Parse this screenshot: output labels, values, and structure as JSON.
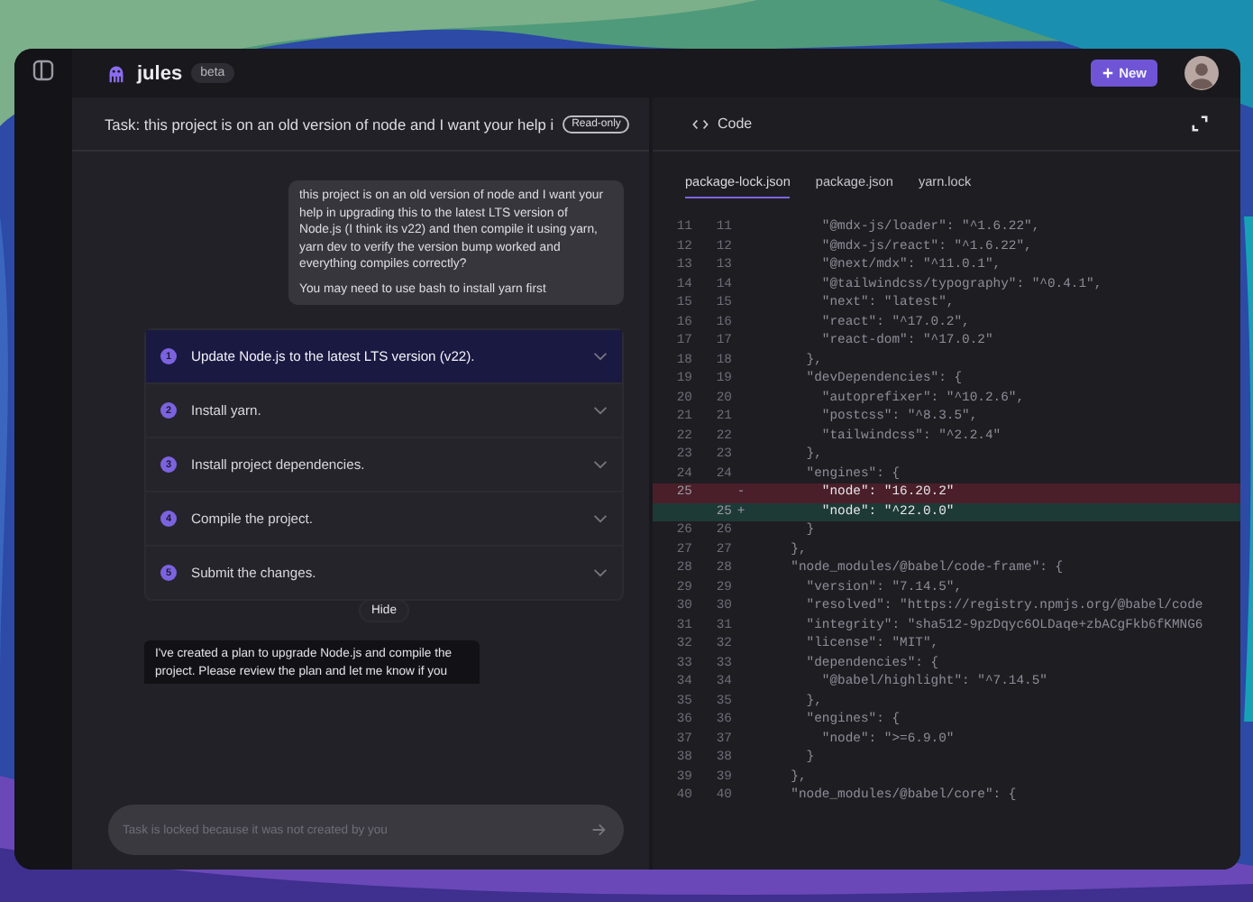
{
  "app": {
    "name": "jules",
    "badge": "beta"
  },
  "new_button": {
    "label": "New"
  },
  "task": {
    "title": "Task: this project is on an old version of node and I want your help i",
    "badge": "Read-only"
  },
  "user_message": {
    "paragraphs": [
      "this project is on an old version of node and I want your help in upgrading this to the latest LTS version of Node.js (I think its v22) and then compile it using yarn, yarn dev to verify the version bump worked and everything compiles correctly?",
      "You may need to use bash to install yarn first"
    ]
  },
  "plan": {
    "steps": [
      {
        "number": "1",
        "text": "Update Node.js to the latest LTS version (v22).",
        "selected": true
      },
      {
        "number": "2",
        "text": "Install yarn.",
        "selected": false
      },
      {
        "number": "3",
        "text": "Install project dependencies.",
        "selected": false
      },
      {
        "number": "4",
        "text": "Compile the project.",
        "selected": false
      },
      {
        "number": "5",
        "text": "Submit the changes.",
        "selected": false
      }
    ],
    "toggle": "Hide"
  },
  "assistant_message": {
    "text": "I've created a plan to upgrade Node.js and compile the project. Please review the plan and let me know if you"
  },
  "composer": {
    "placeholder": "Task is locked because it was not created by you"
  },
  "code_panel": {
    "title": "Code",
    "tabs": [
      {
        "label": "package-lock.json",
        "selected": true
      },
      {
        "label": "package.json",
        "selected": false
      },
      {
        "label": "yarn.lock",
        "selected": false
      }
    ],
    "lines": [
      {
        "kind": "context",
        "old": "11",
        "new": "11",
        "text": "      \"@mdx-js/loader\": \"^1.6.22\","
      },
      {
        "kind": "context",
        "old": "12",
        "new": "12",
        "text": "      \"@mdx-js/react\": \"^1.6.22\","
      },
      {
        "kind": "context",
        "old": "13",
        "new": "13",
        "text": "      \"@next/mdx\": \"^11.0.1\","
      },
      {
        "kind": "context",
        "old": "14",
        "new": "14",
        "text": "      \"@tailwindcss/typography\": \"^0.4.1\","
      },
      {
        "kind": "context",
        "old": "15",
        "new": "15",
        "text": "      \"next\": \"latest\","
      },
      {
        "kind": "context",
        "old": "16",
        "new": "16",
        "text": "      \"react\": \"^17.0.2\","
      },
      {
        "kind": "context",
        "old": "17",
        "new": "17",
        "text": "      \"react-dom\": \"^17.0.2\""
      },
      {
        "kind": "context",
        "old": "18",
        "new": "18",
        "text": "    },"
      },
      {
        "kind": "context",
        "old": "19",
        "new": "19",
        "text": "    \"devDependencies\": {"
      },
      {
        "kind": "context",
        "old": "20",
        "new": "20",
        "text": "      \"autoprefixer\": \"^10.2.6\","
      },
      {
        "kind": "context",
        "old": "21",
        "new": "21",
        "text": "      \"postcss\": \"^8.3.5\","
      },
      {
        "kind": "context",
        "old": "22",
        "new": "22",
        "text": "      \"tailwindcss\": \"^2.2.4\""
      },
      {
        "kind": "context",
        "old": "23",
        "new": "23",
        "text": "    },"
      },
      {
        "kind": "context",
        "old": "24",
        "new": "24",
        "text": "    \"engines\": {"
      },
      {
        "kind": "removed",
        "old": "25",
        "marker": "-",
        "text": "      \"node\": \"16.20.2\""
      },
      {
        "kind": "added",
        "new": "25",
        "marker": "+",
        "text": "      \"node\": \"^22.0.0\""
      },
      {
        "kind": "context",
        "old": "26",
        "new": "26",
        "text": "    }"
      },
      {
        "kind": "context",
        "old": "27",
        "new": "27",
        "text": "  },"
      },
      {
        "kind": "context",
        "old": "28",
        "new": "28",
        "text": "  \"node_modules/@babel/code-frame\": {"
      },
      {
        "kind": "context",
        "old": "29",
        "new": "29",
        "text": "    \"version\": \"7.14.5\","
      },
      {
        "kind": "context",
        "old": "30",
        "new": "30",
        "text": "    \"resolved\": \"https://registry.npmjs.org/@babel/code"
      },
      {
        "kind": "context",
        "old": "31",
        "new": "31",
        "text": "    \"integrity\": \"sha512-9pzDqyc6OLDaqe+zbACgFkb6fKMNG6"
      },
      {
        "kind": "context",
        "old": "32",
        "new": "32",
        "text": "    \"license\": \"MIT\","
      },
      {
        "kind": "context",
        "old": "33",
        "new": "33",
        "text": "    \"dependencies\": {"
      },
      {
        "kind": "context",
        "old": "34",
        "new": "34",
        "text": "      \"@babel/highlight\": \"^7.14.5\""
      },
      {
        "kind": "context",
        "old": "35",
        "new": "35",
        "text": "    },"
      },
      {
        "kind": "context",
        "old": "36",
        "new": "36",
        "text": "    \"engines\": {"
      },
      {
        "kind": "context",
        "old": "37",
        "new": "37",
        "text": "      \"node\": \">=6.9.0\""
      },
      {
        "kind": "context",
        "old": "38",
        "new": "38",
        "text": "    }"
      },
      {
        "kind": "context",
        "old": "39",
        "new": "39",
        "text": "  },"
      },
      {
        "kind": "context",
        "old": "40",
        "new": "40",
        "text": "  \"node_modules/@babel/core\": {"
      }
    ]
  }
}
